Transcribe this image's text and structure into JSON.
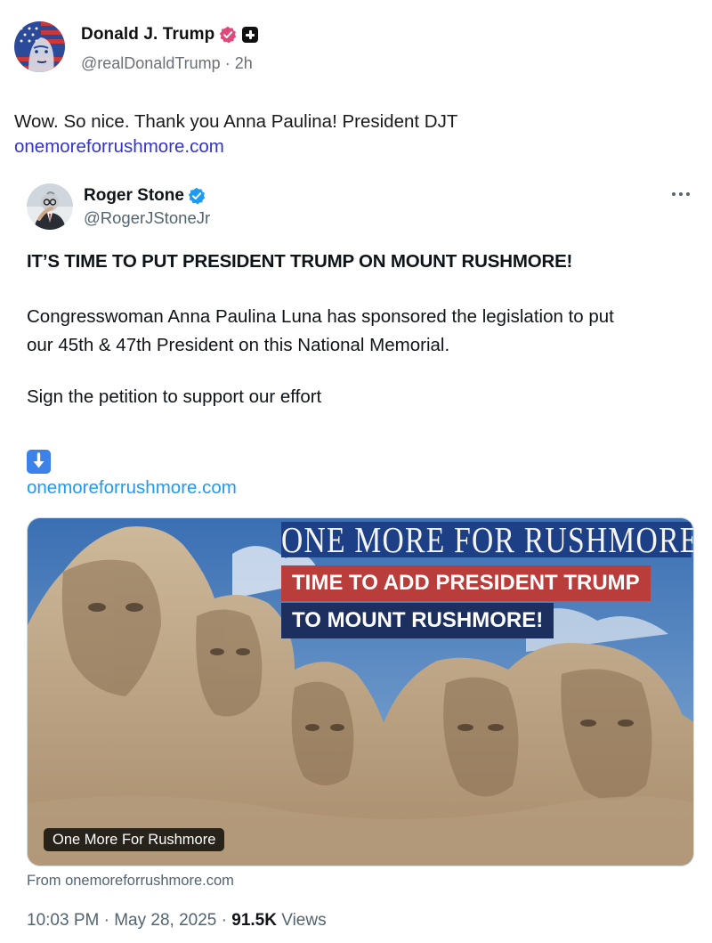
{
  "post": {
    "author_name": "Donald J. Trump",
    "handle": "@realDonaldTrump",
    "separator": "·",
    "time_ago": "2h",
    "text": "Wow. So nice. Thank you Anna Paulina! President DJT",
    "link": "onemoreforrushmore.com",
    "icons": [
      "verified-badge-icon",
      "plus-badge-icon",
      "avatar"
    ]
  },
  "quoted_post": {
    "author_name": "Roger Stone",
    "handle": "@RogerJStoneJr",
    "headline": "IT’S TIME TO PUT PRESIDENT TRUMP ON MOUNT RUSHMORE!",
    "paragraph_line1": "Congresswoman Anna Paulina Luna has sponsored the legislation to put",
    "paragraph_line2": "our 45th & 47th President on this National Memorial.",
    "sign_line": "Sign the petition to support our effort",
    "link": "onemoreforrushmore.com",
    "card": {
      "title": "ONE MORE FOR RUSHMORE",
      "line1": "TIME TO ADD PRESIDENT TRUMP",
      "line2": "TO MOUNT RUSHMORE!",
      "label": "One More For Rushmore",
      "source": "From onemoreforrushmore.com"
    },
    "time": "10:03 PM",
    "date": "May 28, 2025",
    "dot": "·",
    "views_count": "91.5K",
    "views_label": "Views",
    "icons": [
      "more-options-icon",
      "down-arrow-icon",
      "verified-badge-icon"
    ]
  },
  "colors": {
    "link_truth": "#3333cc",
    "link_x": "#1d9bf0",
    "verified_pink": "#e0477a",
    "verified_blue": "#1d9bf0",
    "banner_navy": "#1c3f86",
    "banner_red": "#b93e3b"
  }
}
